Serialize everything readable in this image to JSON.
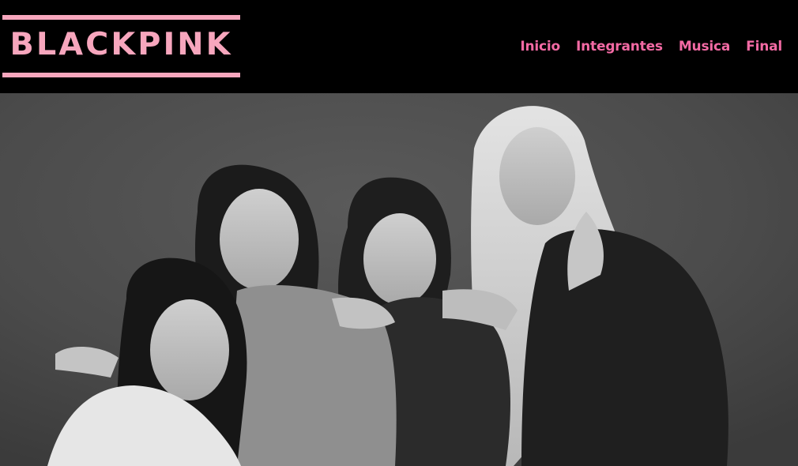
{
  "brand": {
    "logo_text": "BLACKPINK",
    "accent_color": "#f7a6bd",
    "nav_color": "#f36aa4"
  },
  "nav": {
    "items": [
      {
        "label": "Inicio"
      },
      {
        "label": "Integrantes"
      },
      {
        "label": "Musica"
      },
      {
        "label": "Final"
      }
    ]
  },
  "hero": {
    "description_icon": "group-photo-image",
    "tone": "black-and-white"
  }
}
